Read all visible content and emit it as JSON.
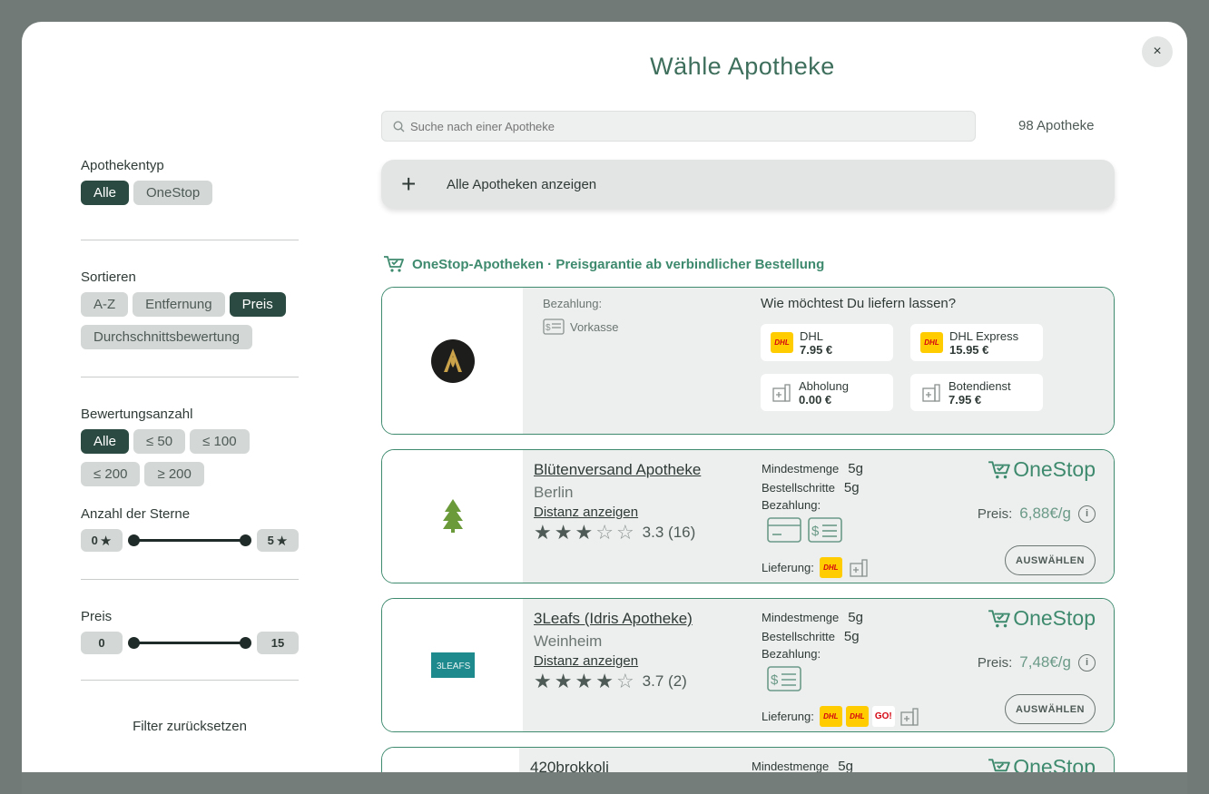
{
  "modal": {
    "title": "Wähle Apotheke",
    "close_label": "×"
  },
  "sidebar": {
    "type_title": "Apothekentyp",
    "type_options": [
      "Alle",
      "OneStop"
    ],
    "sort_title": "Sortieren",
    "sort_options": [
      "A-Z",
      "Entfernung",
      "Preis",
      "Durchschnittsbewertung"
    ],
    "reviews_title": "Bewertungsanzahl",
    "reviews_options": [
      "Alle",
      "≤ 50",
      "≤ 100",
      "≤ 200",
      "≥ 200"
    ],
    "stars_title": "Anzahl der Sterne",
    "stars_min": "0",
    "stars_max": "5",
    "price_title": "Preis",
    "price_min": "0",
    "price_max": "15",
    "reset_label": "Filter zurücksetzen"
  },
  "search": {
    "placeholder": "Suche nach einer Apotheke",
    "count": "98 Apotheke"
  },
  "show_all": {
    "icon": "plus-icon",
    "label": "Alle Apotheken anzeigen"
  },
  "onestop_section": {
    "icon": "cart-icon",
    "label": "OneStop-Apotheken · Preisgarantie ab verbindlicher Bestellung"
  },
  "first_card": {
    "payment_label": "Bezahlung:",
    "payment_method": "Vorkasse",
    "delivery_question": "Wie möchtest Du liefern lassen?",
    "options": [
      {
        "name": "DHL",
        "price": "7.95 €",
        "icon": "dhl-icon"
      },
      {
        "name": "DHL Express",
        "price": "15.95 €",
        "icon": "dhl-icon"
      },
      {
        "name": "Abholung",
        "price": "0.00 €",
        "icon": "pharmacy-icon"
      },
      {
        "name": "Botendienst",
        "price": "7.95 €",
        "icon": "pharmacy-icon"
      }
    ]
  },
  "labels": {
    "min_amount": "Mindestmenge",
    "order_steps": "Bestellschritte",
    "payment": "Bezahlung:",
    "delivery": "Lieferung:",
    "price": "Preis:",
    "select": "AUSWÄHLEN",
    "distance": "Distanz anzeigen",
    "onestop_brand": "OneStop",
    "dhl": "DHL",
    "go": "GO!"
  },
  "pharmacies": [
    {
      "name": "Blütenversand Apotheke",
      "city": "Berlin",
      "rating": 3,
      "rating_text": "3.3 (16)",
      "min_amount": "5g",
      "order_steps": "5g",
      "price": "6,88€/g"
    },
    {
      "name": "3Leafs (Idris Apotheke)",
      "city": "Weinheim",
      "rating": 4,
      "rating_text": "3.7 (2)",
      "min_amount": "5g",
      "order_steps": "5g",
      "price": "7,48€/g"
    },
    {
      "name": "420brokkoli",
      "min_amount": "5g"
    }
  ]
}
